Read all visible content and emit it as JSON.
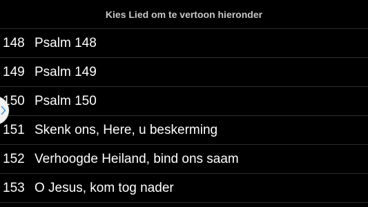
{
  "header": {
    "title": "Kies Lied om te vertoon hieronder"
  },
  "songs": [
    {
      "number": "148",
      "title": "Psalm 148"
    },
    {
      "number": "149",
      "title": "Psalm 149"
    },
    {
      "number": "150",
      "title": "Psalm 150"
    },
    {
      "number": "151",
      "title": "Skenk ons, Here, u beskerming"
    },
    {
      "number": "152",
      "title": "Verhoogde Heiland, bind ons saam"
    },
    {
      "number": "153",
      "title": "O Jesus, kom tog nader"
    }
  ],
  "drawer_handle": {
    "icon": "chevron-right-icon",
    "color": "#4a90d9"
  }
}
